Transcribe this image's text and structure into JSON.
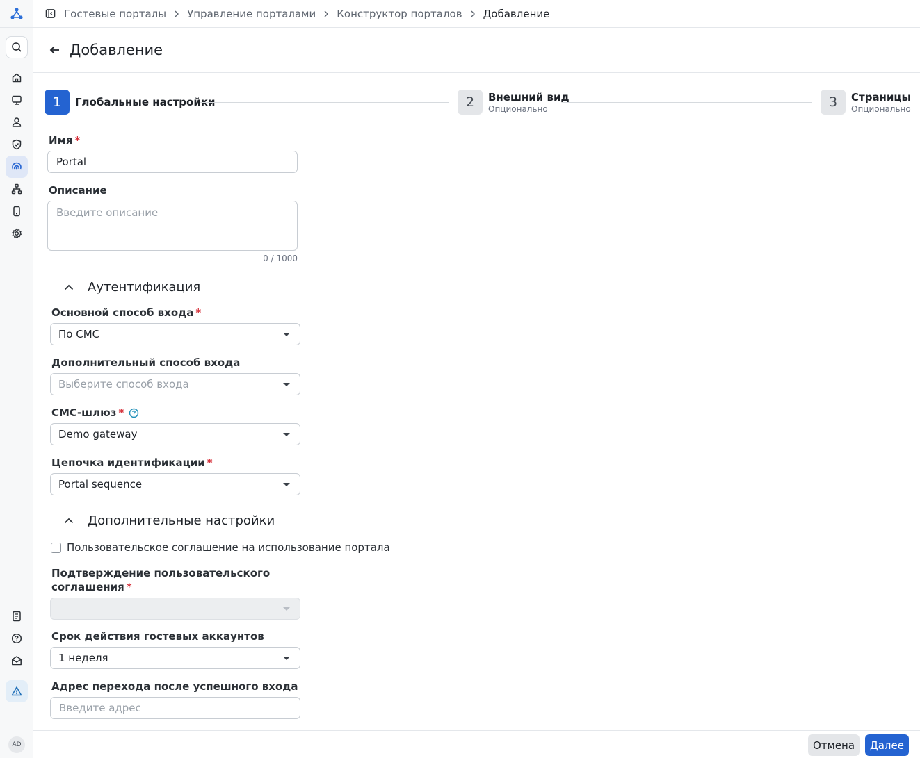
{
  "breadcrumb": [
    "Гостевые порталы",
    "Управление порталами",
    "Конструктор порталов",
    "Добавление"
  ],
  "page_title": "Добавление",
  "steps": [
    {
      "num": "1",
      "title": "Глобальные настройки",
      "sub": ""
    },
    {
      "num": "2",
      "title": "Внешний вид",
      "sub": "Опционально"
    },
    {
      "num": "3",
      "title": "Страницы",
      "sub": "Опционально"
    }
  ],
  "form": {
    "name_label": "Имя",
    "name_value": "Portal",
    "desc_label": "Описание",
    "desc_placeholder": "Введите описание",
    "desc_counter": "0 / 1000"
  },
  "auth": {
    "title": "Аутентификация",
    "primary_label": "Основной способ входа",
    "primary_value": "По СМС",
    "secondary_label": "Дополнительный способ входа",
    "secondary_placeholder": "Выберите способ входа",
    "gateway_label": "СМС-шлюз",
    "gateway_value": "Demo gateway",
    "chain_label": "Цепочка идентификации",
    "chain_value": "Portal sequence"
  },
  "extra": {
    "title": "Дополнительные настройки",
    "agreement_checkbox": "Пользовательское соглашение на использование портала",
    "confirm_label_1": "Подтверждение пользовательского",
    "confirm_label_2": "соглашения",
    "expiry_label": "Срок действия гостевых аккаунтов",
    "expiry_value": "1 неделя",
    "redirect_label": "Адрес перехода после успешного входа",
    "redirect_placeholder": "Введите адрес"
  },
  "footer": {
    "cancel": "Отмена",
    "next": "Далее"
  },
  "user": {
    "initials": "AD"
  },
  "required_mark": "*",
  "colors": {
    "accent": "#2463d1",
    "required": "#d6303a",
    "help": "#1f8fb8"
  }
}
